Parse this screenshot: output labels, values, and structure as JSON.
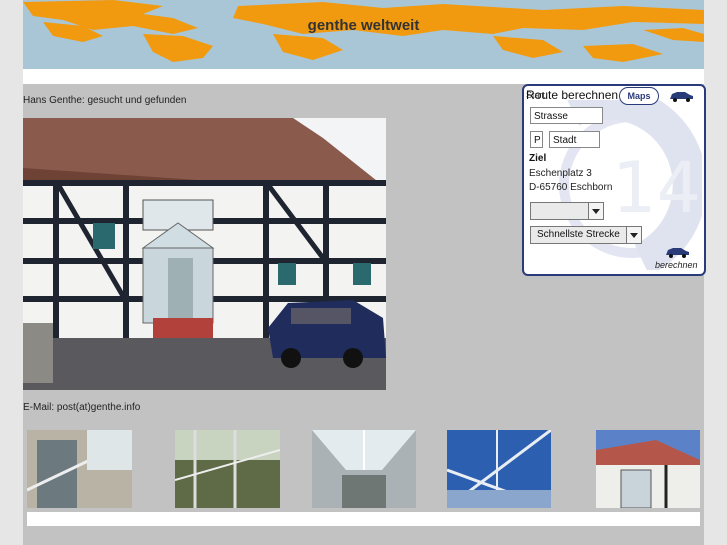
{
  "header": {
    "title": "genthe weltweit"
  },
  "main": {
    "tagline": "Hans Genthe: gesucht und gefunden",
    "photo_alt": "main-house-photo",
    "email": "E-Mail: post(at)genthe.info"
  },
  "route": {
    "title": "Route berechnen",
    "overlap_label": "Start",
    "maps_logo": "Maps",
    "street_value": "Strasse",
    "plz_value": "P",
    "city_value": "Stadt",
    "ziel_label": "Ziel",
    "dest_street": "Eschenplatz 3",
    "dest_city": "D-65760 Eschborn",
    "first_select_value": "",
    "route_type_value": "Schnellste Strecke",
    "calc_label": "berechnen"
  },
  "thumbnails": [
    "thumb-staircase",
    "thumb-glass-interior",
    "thumb-atrium",
    "thumb-glass-roof",
    "thumb-house-exterior"
  ],
  "colors": {
    "sky": "#a9c6d6",
    "land": "#f29a0f",
    "accent": "#2a3b7a",
    "page": "#c2c2c2"
  }
}
